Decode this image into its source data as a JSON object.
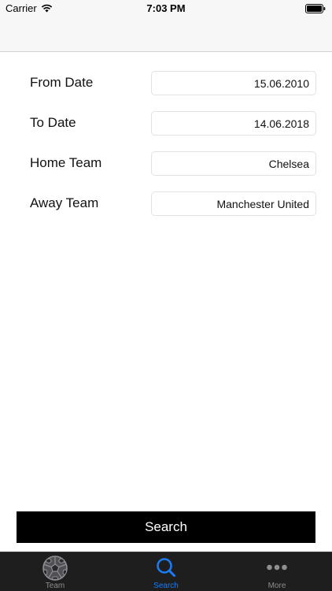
{
  "status_bar": {
    "carrier": "Carrier",
    "time": "7:03 PM"
  },
  "form": {
    "fields": [
      {
        "label": "From Date",
        "value": "15.06.2010"
      },
      {
        "label": "To Date",
        "value": "14.06.2018"
      },
      {
        "label": "Home Team",
        "value": "Chelsea"
      },
      {
        "label": "Away Team",
        "value": "Manchester United"
      }
    ]
  },
  "search_button": {
    "label": "Search"
  },
  "tab_bar": {
    "active_color": "#1a7bf2",
    "inactive_color": "#8e8e93",
    "tabs": [
      {
        "label": "Team",
        "icon": "soccer-ball-icon",
        "selected": false
      },
      {
        "label": "Search",
        "icon": "magnifier-icon",
        "selected": true
      },
      {
        "label": "More",
        "icon": "more-dots-icon",
        "selected": false
      }
    ]
  }
}
